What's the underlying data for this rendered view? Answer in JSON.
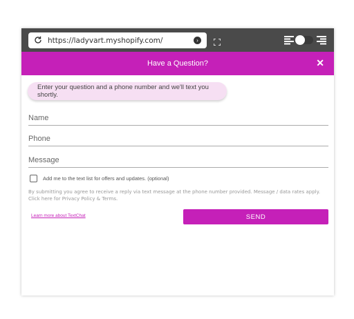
{
  "browser": {
    "url": "https://ladyvart.myshopify.com/",
    "icons": [
      "reload-icon",
      "go-icon",
      "fullscreen-icon",
      "align-left-icon",
      "toggle-switch",
      "align-right-icon"
    ]
  },
  "chat": {
    "title": "Have a Question?",
    "close_label": "✕",
    "intro": "Enter your question and a phone number and we'll text you shortly.",
    "fields": {
      "name_placeholder": "Name",
      "phone_placeholder": "Phone",
      "message_placeholder": "Message"
    },
    "optin_label": "Add me to the text list for offers and updates. (optional)",
    "disclaimer": "By submitting you agree to receive a reply via text message at the phone number provided. Message / data rates apply. Click here for Privacy Policy & Terms.",
    "learn_more": "Learn more about TextChat",
    "send_label": "SEND"
  },
  "colors": {
    "accent": "#c520b8",
    "browser_bar": "#4a4a4a",
    "bubble": "#f6dff3"
  }
}
